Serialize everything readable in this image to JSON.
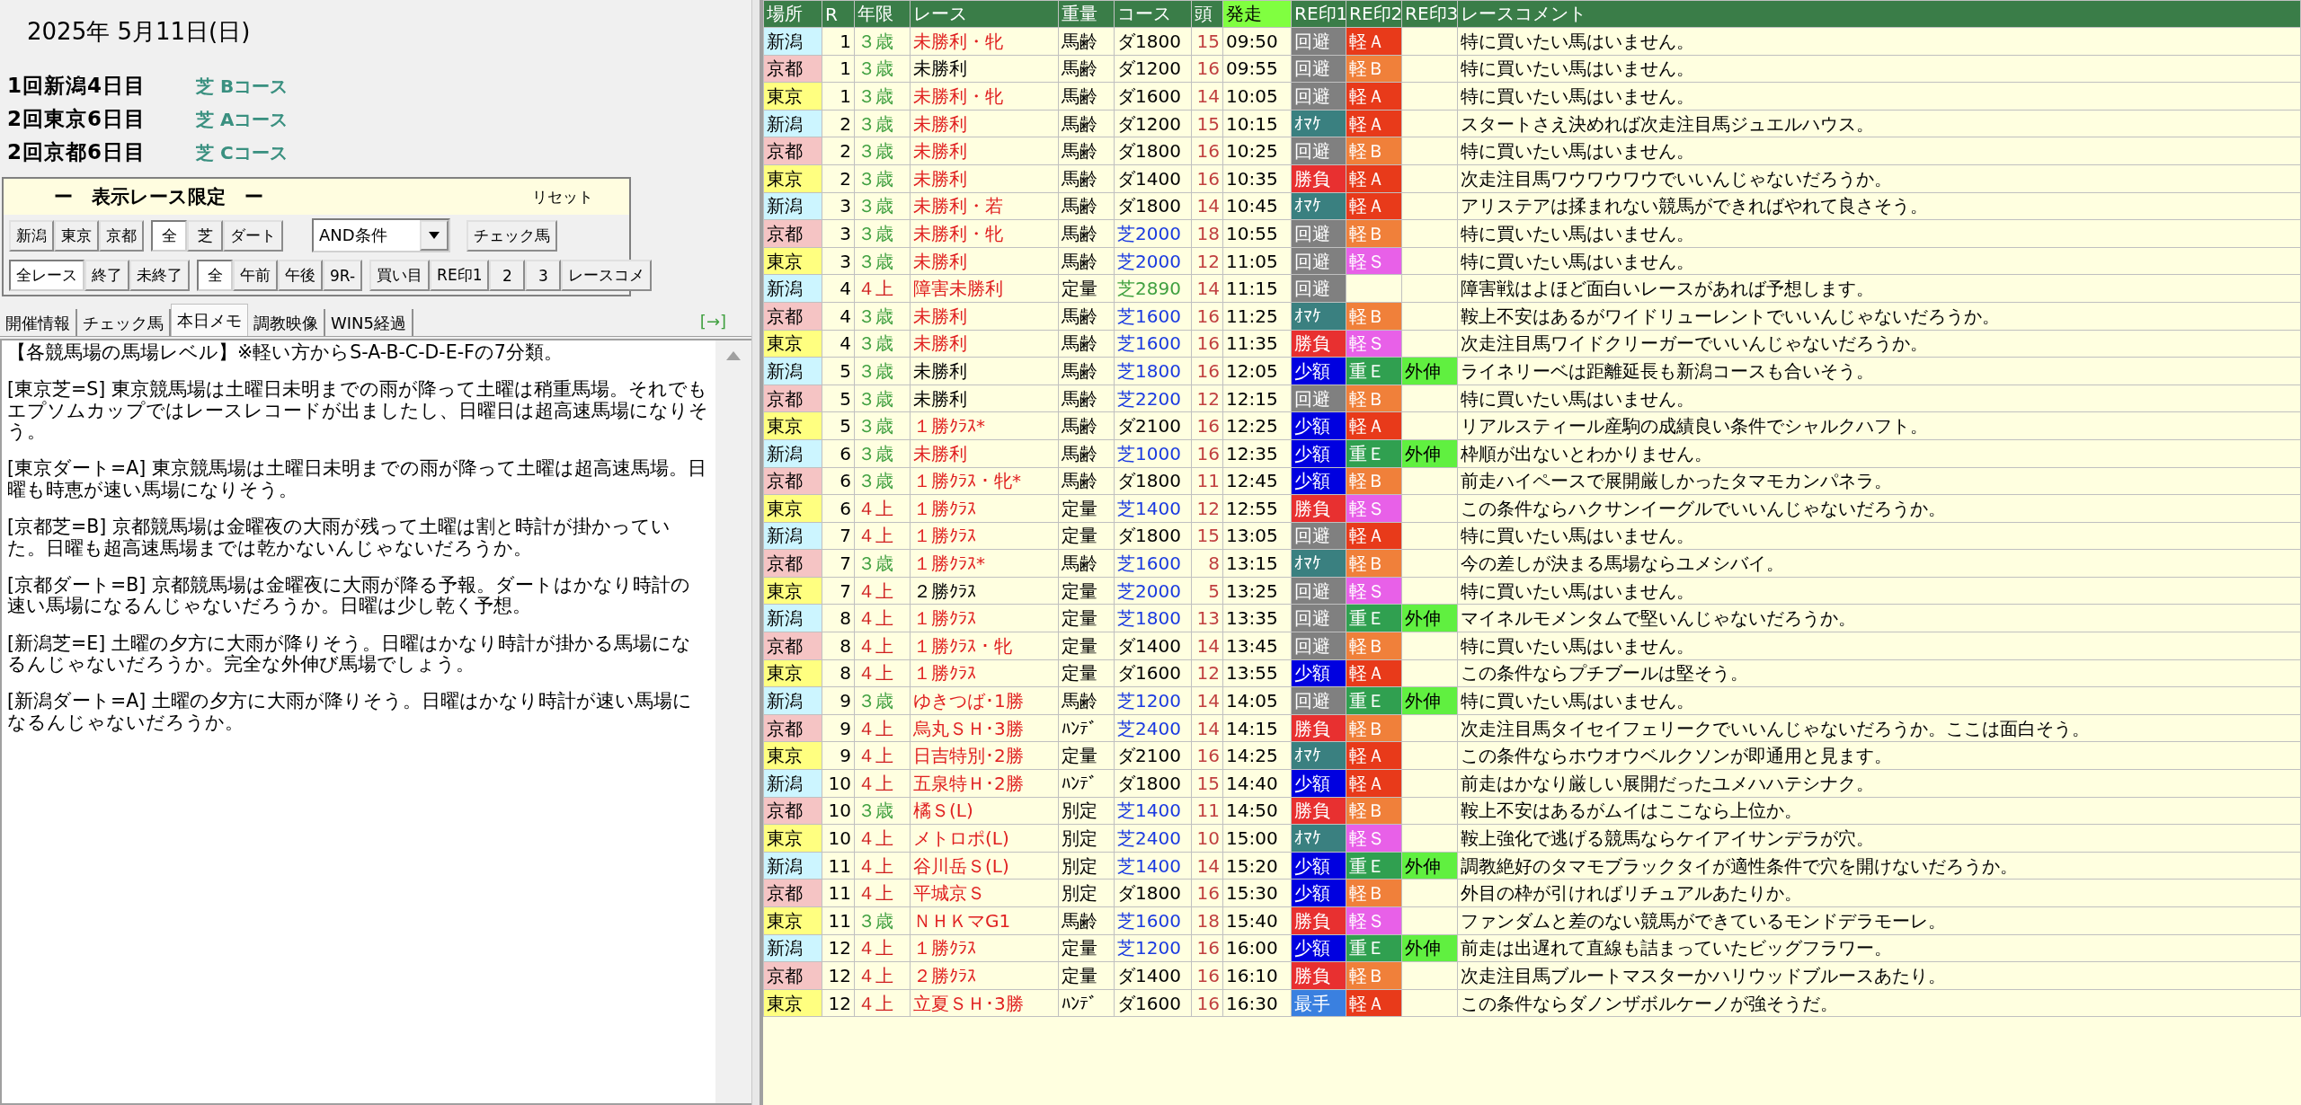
{
  "date": "2025年 5月11日(日)",
  "meetings": [
    {
      "label": "1回新潟4日目",
      "course": "芝 Bコース"
    },
    {
      "label": "2回東京6日目",
      "course": "芝 Aコース"
    },
    {
      "label": "2回京都6日目",
      "course": "芝 Cコース"
    }
  ],
  "filter": {
    "title": "ー　表示レース限定　ー",
    "reset": "リセット",
    "rows": [
      {
        "items": [
          {
            "kind": "group",
            "buttons": [
              {
                "label": "新潟",
                "selected": false
              },
              {
                "label": "東京",
                "selected": false
              },
              {
                "label": "京都",
                "selected": false
              }
            ]
          },
          {
            "kind": "group",
            "buttons": [
              {
                "label": "全",
                "selected": true
              },
              {
                "label": "芝",
                "selected": false
              },
              {
                "label": "ダート",
                "selected": false
              }
            ]
          },
          {
            "kind": "select",
            "value": "AND条件"
          },
          {
            "kind": "group",
            "buttons": [
              {
                "label": "チェック馬",
                "selected": false
              }
            ]
          }
        ]
      },
      {
        "items": [
          {
            "kind": "group",
            "buttons": [
              {
                "label": "全レース",
                "selected": true
              },
              {
                "label": "終了",
                "selected": false
              },
              {
                "label": "未終了",
                "selected": false
              }
            ]
          },
          {
            "kind": "group",
            "buttons": [
              {
                "label": "全",
                "selected": true
              },
              {
                "label": "午前",
                "selected": false
              },
              {
                "label": "午後",
                "selected": false
              },
              {
                "label": "9R-",
                "selected": false
              }
            ]
          },
          {
            "kind": "group",
            "buttons": [
              {
                "label": "買い目",
                "selected": false
              },
              {
                "label": "RE印1",
                "selected": false
              },
              {
                "label": "2",
                "selected": false
              },
              {
                "label": "3",
                "selected": false
              },
              {
                "label": "レースコメ",
                "selected": false
              }
            ]
          }
        ]
      }
    ]
  },
  "tabs": [
    {
      "label": "開催情報",
      "selected": false
    },
    {
      "label": "チェック馬",
      "selected": false
    },
    {
      "label": "本日メモ",
      "selected": true
    },
    {
      "label": "調教映像",
      "selected": false
    },
    {
      "label": "WIN5経過",
      "selected": false
    }
  ],
  "expand_link": "[→]",
  "memo": [
    "【各競馬場の馬場レベル】※軽い方からS-A-B-C-D-E-Fの7分類。",
    "[東京芝=S] 東京競馬場は土曜日未明までの雨が降って土曜は稍重馬場。それでもエプソムカップではレースレコードが出ましたし、日曜日は超高速馬場になりそう。",
    "[東京ダート=A] 東京競馬場は土曜日未明までの雨が降って土曜は超高速馬場。日曜も時恵が速い馬場になりそう。",
    "[京都芝=B] 京都競馬場は金曜夜の大雨が残って土曜は割と時計が掛かっていた。日曜も超高速馬場までは乾かないんじゃないだろうか。",
    "[京都ダート=B] 京都競馬場は金曜夜に大雨が降る予報。ダートはかなり時計の速い馬場になるんじゃないだろうか。日曜は少し乾く予想。",
    "[新潟芝=E] 土曜の夕方に大雨が降りそう。日曜はかなり時計が掛かる馬場になるんじゃないだろうか。完全な外伸び馬場でしょう。",
    "[新潟ダート=A] 土曜の夕方に大雨が降りそう。日曜はかなり時計が速い馬場になるんじゃないだろうか。"
  ],
  "table": {
    "columns": [
      "場所",
      "R",
      "年限",
      "レース",
      "重量",
      "コース",
      "頭",
      "発走",
      "RE印1",
      "RE印2",
      "RE印3",
      "レースコメント"
    ],
    "rows": [
      {
        "venue": {
          "text": "新潟",
          "color": "#ccf5ff"
        },
        "r": "1",
        "age": {
          "text": "３歳",
          "color": "#40a040"
        },
        "race": {
          "text": "未勝利・牝",
          "color": "#e02020"
        },
        "weight": "馬齢",
        "course": {
          "text": "ダ1800",
          "color": "#000000"
        },
        "heads": "15",
        "start": "09:50",
        "r1": {
          "text": "回避",
          "color": "#808080"
        },
        "r2": {
          "text": "軽Ａ",
          "color": "#e83a1a"
        },
        "comment": "特に買いたい馬はいません。"
      },
      {
        "venue": {
          "text": "京都",
          "color": "#f5c4c4"
        },
        "r": "1",
        "age": {
          "text": "３歳",
          "color": "#40a040"
        },
        "race": {
          "text": "未勝利",
          "color": "#000000"
        },
        "weight": "馬齢",
        "course": {
          "text": "ダ1200",
          "color": "#000000"
        },
        "heads": "16",
        "start": "09:55",
        "r1": {
          "text": "回避",
          "color": "#808080"
        },
        "r2": {
          "text": "軽Ｂ",
          "color": "#f0803a"
        },
        "comment": "特に買いたい馬はいません。"
      },
      {
        "venue": {
          "text": "東京",
          "color": "#ffff80"
        },
        "r": "1",
        "age": {
          "text": "３歳",
          "color": "#40a040"
        },
        "race": {
          "text": "未勝利・牝",
          "color": "#e02020"
        },
        "weight": "馬齢",
        "course": {
          "text": "ダ1600",
          "color": "#000000"
        },
        "heads": "14",
        "start": "10:05",
        "r1": {
          "text": "回避",
          "color": "#808080"
        },
        "r2": {
          "text": "軽Ａ",
          "color": "#e83a1a"
        },
        "comment": "特に買いたい馬はいません。"
      },
      {
        "venue": {
          "text": "新潟",
          "color": "#ccf5ff"
        },
        "r": "2",
        "age": {
          "text": "３歳",
          "color": "#40a040"
        },
        "race": {
          "text": "未勝利",
          "color": "#e02020"
        },
        "weight": "馬齢",
        "course": {
          "text": "ダ1200",
          "color": "#000000"
        },
        "heads": "15",
        "start": "10:15",
        "r1": {
          "text": "ｵﾏｹ",
          "color": "#3a8080"
        },
        "r2": {
          "text": "軽Ａ",
          "color": "#e83a1a"
        },
        "comment": "スタートさえ決めれば次走注目馬ジュエルハウス。"
      },
      {
        "venue": {
          "text": "京都",
          "color": "#f5c4c4"
        },
        "r": "2",
        "age": {
          "text": "３歳",
          "color": "#40a040"
        },
        "race": {
          "text": "未勝利",
          "color": "#e02020"
        },
        "weight": "馬齢",
        "course": {
          "text": "ダ1800",
          "color": "#000000"
        },
        "heads": "16",
        "start": "10:25",
        "r1": {
          "text": "回避",
          "color": "#808080"
        },
        "r2": {
          "text": "軽Ｂ",
          "color": "#f0803a"
        },
        "comment": "特に買いたい馬はいません。"
      },
      {
        "venue": {
          "text": "東京",
          "color": "#ffff80"
        },
        "r": "2",
        "age": {
          "text": "３歳",
          "color": "#40a040"
        },
        "race": {
          "text": "未勝利",
          "color": "#e02020"
        },
        "weight": "馬齢",
        "course": {
          "text": "ダ1400",
          "color": "#000000"
        },
        "heads": "16",
        "start": "10:35",
        "r1": {
          "text": "勝負",
          "color": "#e83030"
        },
        "r2": {
          "text": "軽Ａ",
          "color": "#e83a1a"
        },
        "comment": "次走注目馬ワウワウワウでいいんじゃないだろうか。"
      },
      {
        "venue": {
          "text": "新潟",
          "color": "#ccf5ff"
        },
        "r": "3",
        "age": {
          "text": "３歳",
          "color": "#40a040"
        },
        "race": {
          "text": "未勝利・若",
          "color": "#e02020"
        },
        "weight": "馬齢",
        "course": {
          "text": "ダ1800",
          "color": "#000000"
        },
        "heads": "14",
        "start": "10:45",
        "r1": {
          "text": "ｵﾏｹ",
          "color": "#3a8080"
        },
        "r2": {
          "text": "軽Ａ",
          "color": "#e83a1a"
        },
        "comment": "アリステアは揉まれない競馬ができればやれて良さそう。"
      },
      {
        "venue": {
          "text": "京都",
          "color": "#f5c4c4"
        },
        "r": "3",
        "age": {
          "text": "３歳",
          "color": "#40a040"
        },
        "race": {
          "text": "未勝利・牝",
          "color": "#e02020"
        },
        "weight": "馬齢",
        "course": {
          "text": "芝2000",
          "color": "#1a3ae0"
        },
        "heads": "18",
        "start": "10:55",
        "r1": {
          "text": "回避",
          "color": "#808080"
        },
        "r2": {
          "text": "軽Ｂ",
          "color": "#f0803a"
        },
        "comment": "特に買いたい馬はいません。"
      },
      {
        "venue": {
          "text": "東京",
          "color": "#ffff80"
        },
        "r": "3",
        "age": {
          "text": "３歳",
          "color": "#40a040"
        },
        "race": {
          "text": "未勝利",
          "color": "#e02020"
        },
        "weight": "馬齢",
        "course": {
          "text": "芝2000",
          "color": "#1a3ae0"
        },
        "heads": "12",
        "start": "11:05",
        "r1": {
          "text": "回避",
          "color": "#808080"
        },
        "r2": {
          "text": "軽Ｓ",
          "color": "#e860e8"
        },
        "comment": "特に買いたい馬はいません。"
      },
      {
        "venue": {
          "text": "新潟",
          "color": "#ccf5ff"
        },
        "r": "4",
        "age": {
          "text": "４上",
          "color": "#d02020"
        },
        "race": {
          "text": "障害未勝利",
          "color": "#e02020"
        },
        "weight": "定量",
        "course": {
          "text": "芝2890",
          "color": "#40a040"
        },
        "heads": "14",
        "start": "11:15",
        "r1": {
          "text": "回避",
          "color": "#808080"
        },
        "comment": "障害戦はよほど面白いレースがあれば予想します。"
      },
      {
        "venue": {
          "text": "京都",
          "color": "#f5c4c4"
        },
        "r": "4",
        "age": {
          "text": "３歳",
          "color": "#40a040"
        },
        "race": {
          "text": "未勝利",
          "color": "#e02020"
        },
        "weight": "馬齢",
        "course": {
          "text": "芝1600",
          "color": "#1a3ae0"
        },
        "heads": "16",
        "start": "11:25",
        "r1": {
          "text": "ｵﾏｹ",
          "color": "#3a8080"
        },
        "r2": {
          "text": "軽Ｂ",
          "color": "#f0803a"
        },
        "comment": "鞍上不安はあるがワイドリューレントでいいんじゃないだろうか。"
      },
      {
        "venue": {
          "text": "東京",
          "color": "#ffff80"
        },
        "r": "4",
        "age": {
          "text": "３歳",
          "color": "#40a040"
        },
        "race": {
          "text": "未勝利",
          "color": "#e02020"
        },
        "weight": "馬齢",
        "course": {
          "text": "芝1600",
          "color": "#1a3ae0"
        },
        "heads": "16",
        "start": "11:35",
        "r1": {
          "text": "勝負",
          "color": "#e83030"
        },
        "r2": {
          "text": "軽Ｓ",
          "color": "#e860e8"
        },
        "comment": "次走注目馬ワイドクリーガーでいいんじゃないだろうか。"
      },
      {
        "venue": {
          "text": "新潟",
          "color": "#ccf5ff"
        },
        "r": "5",
        "age": {
          "text": "３歳",
          "color": "#40a040"
        },
        "race": {
          "text": "未勝利",
          "color": "#000000"
        },
        "weight": "馬齢",
        "course": {
          "text": "芝1800",
          "color": "#1a3ae0"
        },
        "heads": "16",
        "start": "12:05",
        "r1": {
          "text": "少額",
          "color": "#0000e0"
        },
        "r2": {
          "text": "重Ｅ",
          "color": "#30a050"
        },
        "r3": {
          "text": "外伸",
          "color": "#60f040"
        },
        "comment": "ライネリーベは距離延長も新潟コースも合いそう。"
      },
      {
        "venue": {
          "text": "京都",
          "color": "#f5c4c4"
        },
        "r": "5",
        "age": {
          "text": "３歳",
          "color": "#40a040"
        },
        "race": {
          "text": "未勝利",
          "color": "#000000"
        },
        "weight": "馬齢",
        "course": {
          "text": "芝2200",
          "color": "#1a3ae0"
        },
        "heads": "12",
        "start": "12:15",
        "r1": {
          "text": "回避",
          "color": "#808080"
        },
        "r2": {
          "text": "軽Ｂ",
          "color": "#f0803a"
        },
        "comment": "特に買いたい馬はいません。"
      },
      {
        "venue": {
          "text": "東京",
          "color": "#ffff80"
        },
        "r": "5",
        "age": {
          "text": "３歳",
          "color": "#40a040"
        },
        "race": {
          "text": "１勝ｸﾗｽ*",
          "color": "#e02020"
        },
        "weight": "馬齢",
        "course": {
          "text": "ダ2100",
          "color": "#000000"
        },
        "heads": "16",
        "start": "12:25",
        "r1": {
          "text": "少額",
          "color": "#0000e0"
        },
        "r2": {
          "text": "軽Ａ",
          "color": "#e83a1a"
        },
        "comment": "リアルスティール産駒の成績良い条件でシャルクハフト。"
      },
      {
        "venue": {
          "text": "新潟",
          "color": "#ccf5ff"
        },
        "r": "6",
        "age": {
          "text": "３歳",
          "color": "#40a040"
        },
        "race": {
          "text": "未勝利",
          "color": "#e02020"
        },
        "weight": "馬齢",
        "course": {
          "text": "芝1000",
          "color": "#1a3ae0"
        },
        "heads": "16",
        "start": "12:35",
        "r1": {
          "text": "少額",
          "color": "#0000e0"
        },
        "r2": {
          "text": "重Ｅ",
          "color": "#30a050"
        },
        "r3": {
          "text": "外伸",
          "color": "#60f040"
        },
        "comment": "枠順が出ないとわかりません。"
      },
      {
        "venue": {
          "text": "京都",
          "color": "#f5c4c4"
        },
        "r": "6",
        "age": {
          "text": "３歳",
          "color": "#40a040"
        },
        "race": {
          "text": "１勝ｸﾗｽ・牝*",
          "color": "#e02020"
        },
        "weight": "馬齢",
        "course": {
          "text": "ダ1800",
          "color": "#000000"
        },
        "heads": "11",
        "start": "12:45",
        "r1": {
          "text": "少額",
          "color": "#0000e0"
        },
        "r2": {
          "text": "軽Ｂ",
          "color": "#f0803a"
        },
        "comment": "前走ハイペースで展開厳しかったタマモカンパネラ。"
      },
      {
        "venue": {
          "text": "東京",
          "color": "#ffff80"
        },
        "r": "6",
        "age": {
          "text": "４上",
          "color": "#d02020"
        },
        "race": {
          "text": "１勝ｸﾗｽ",
          "color": "#e02020"
        },
        "weight": "定量",
        "course": {
          "text": "芝1400",
          "color": "#1a3ae0"
        },
        "heads": "12",
        "start": "12:55",
        "r1": {
          "text": "勝負",
          "color": "#e83030"
        },
        "r2": {
          "text": "軽Ｓ",
          "color": "#e860e8"
        },
        "comment": "この条件ならハクサンイーグルでいいんじゃないだろうか。"
      },
      {
        "venue": {
          "text": "新潟",
          "color": "#ccf5ff"
        },
        "r": "7",
        "age": {
          "text": "４上",
          "color": "#d02020"
        },
        "race": {
          "text": "１勝ｸﾗｽ",
          "color": "#e02020"
        },
        "weight": "定量",
        "course": {
          "text": "ダ1800",
          "color": "#000000"
        },
        "heads": "15",
        "start": "13:05",
        "r1": {
          "text": "回避",
          "color": "#808080"
        },
        "r2": {
          "text": "軽Ａ",
          "color": "#e83a1a"
        },
        "comment": "特に買いたい馬はいません。"
      },
      {
        "venue": {
          "text": "京都",
          "color": "#f5c4c4"
        },
        "r": "7",
        "age": {
          "text": "３歳",
          "color": "#40a040"
        },
        "race": {
          "text": "１勝ｸﾗｽ*",
          "color": "#e02020"
        },
        "weight": "馬齢",
        "course": {
          "text": "芝1600",
          "color": "#1a3ae0"
        },
        "heads": "8",
        "start": "13:15",
        "r1": {
          "text": "ｵﾏｹ",
          "color": "#3a8080"
        },
        "r2": {
          "text": "軽Ｂ",
          "color": "#f0803a"
        },
        "comment": "今の差しが決まる馬場ならユメシバイ。"
      },
      {
        "venue": {
          "text": "東京",
          "color": "#ffff80"
        },
        "r": "7",
        "age": {
          "text": "４上",
          "color": "#d02020"
        },
        "race": {
          "text": "２勝ｸﾗｽ",
          "color": "#000000"
        },
        "weight": "定量",
        "course": {
          "text": "芝2000",
          "color": "#1a3ae0"
        },
        "heads": "5",
        "start": "13:25",
        "r1": {
          "text": "回避",
          "color": "#808080"
        },
        "r2": {
          "text": "軽Ｓ",
          "color": "#e860e8"
        },
        "comment": "特に買いたい馬はいません。"
      },
      {
        "venue": {
          "text": "新潟",
          "color": "#ccf5ff"
        },
        "r": "8",
        "age": {
          "text": "４上",
          "color": "#d02020"
        },
        "race": {
          "text": "１勝ｸﾗｽ",
          "color": "#e02020"
        },
        "weight": "定量",
        "course": {
          "text": "芝1800",
          "color": "#1a3ae0"
        },
        "heads": "13",
        "start": "13:35",
        "r1": {
          "text": "回避",
          "color": "#808080"
        },
        "r2": {
          "text": "重Ｅ",
          "color": "#30a050"
        },
        "r3": {
          "text": "外伸",
          "color": "#60f040"
        },
        "comment": "マイネルモメンタムで堅いんじゃないだろうか。"
      },
      {
        "venue": {
          "text": "京都",
          "color": "#f5c4c4"
        },
        "r": "8",
        "age": {
          "text": "４上",
          "color": "#d02020"
        },
        "race": {
          "text": "１勝ｸﾗｽ・牝",
          "color": "#e02020"
        },
        "weight": "定量",
        "course": {
          "text": "ダ1400",
          "color": "#000000"
        },
        "heads": "14",
        "start": "13:45",
        "r1": {
          "text": "回避",
          "color": "#808080"
        },
        "r2": {
          "text": "軽Ｂ",
          "color": "#f0803a"
        },
        "comment": "特に買いたい馬はいません。"
      },
      {
        "venue": {
          "text": "東京",
          "color": "#ffff80"
        },
        "r": "8",
        "age": {
          "text": "４上",
          "color": "#d02020"
        },
        "race": {
          "text": "１勝ｸﾗｽ",
          "color": "#e02020"
        },
        "weight": "定量",
        "course": {
          "text": "ダ1600",
          "color": "#000000"
        },
        "heads": "12",
        "start": "13:55",
        "r1": {
          "text": "少額",
          "color": "#0000e0"
        },
        "r2": {
          "text": "軽Ａ",
          "color": "#e83a1a"
        },
        "comment": "この条件ならプチブールは堅そう。"
      },
      {
        "venue": {
          "text": "新潟",
          "color": "#ccf5ff"
        },
        "r": "9",
        "age": {
          "text": "３歳",
          "color": "#40a040"
        },
        "race": {
          "text": "ゆきつば･1勝",
          "color": "#e02020"
        },
        "weight": "馬齢",
        "course": {
          "text": "芝1200",
          "color": "#1a3ae0"
        },
        "heads": "14",
        "start": "14:05",
        "r1": {
          "text": "回避",
          "color": "#808080"
        },
        "r2": {
          "text": "重Ｅ",
          "color": "#30a050"
        },
        "r3": {
          "text": "外伸",
          "color": "#60f040"
        },
        "comment": "特に買いたい馬はいません。"
      },
      {
        "venue": {
          "text": "京都",
          "color": "#f5c4c4"
        },
        "r": "9",
        "age": {
          "text": "４上",
          "color": "#d02020"
        },
        "race": {
          "text": "烏丸ＳＨ･3勝",
          "color": "#e02020"
        },
        "weight": "ﾊﾝﾃﾞ",
        "course": {
          "text": "芝2400",
          "color": "#1a3ae0"
        },
        "heads": "14",
        "start": "14:15",
        "r1": {
          "text": "勝負",
          "color": "#e83030"
        },
        "r2": {
          "text": "軽Ｂ",
          "color": "#f0803a"
        },
        "comment": "次走注目馬タイセイフェリークでいいんじゃないだろうか。ここは面白そう。"
      },
      {
        "venue": {
          "text": "東京",
          "color": "#ffff80"
        },
        "r": "9",
        "age": {
          "text": "４上",
          "color": "#d02020"
        },
        "race": {
          "text": "日吉特別･2勝",
          "color": "#e02020"
        },
        "weight": "定量",
        "course": {
          "text": "ダ2100",
          "color": "#000000"
        },
        "heads": "16",
        "start": "14:25",
        "r1": {
          "text": "ｵﾏｹ",
          "color": "#3a8080"
        },
        "r2": {
          "text": "軽Ａ",
          "color": "#e83a1a"
        },
        "comment": "この条件ならホウオウベルクソンが即通用と見ます。"
      },
      {
        "venue": {
          "text": "新潟",
          "color": "#ccf5ff"
        },
        "r": "10",
        "age": {
          "text": "４上",
          "color": "#d02020"
        },
        "race": {
          "text": "五泉特Ｈ･2勝",
          "color": "#e02020"
        },
        "weight": "ﾊﾝﾃﾞ",
        "course": {
          "text": "ダ1800",
          "color": "#000000"
        },
        "heads": "15",
        "start": "14:40",
        "r1": {
          "text": "少額",
          "color": "#0000e0"
        },
        "r2": {
          "text": "軽Ａ",
          "color": "#e83a1a"
        },
        "comment": "前走はかなり厳しい展開だったユメハハテシナク。"
      },
      {
        "venue": {
          "text": "京都",
          "color": "#f5c4c4"
        },
        "r": "10",
        "age": {
          "text": "３歳",
          "color": "#40a040"
        },
        "race": {
          "text": "橘Ｓ(L)",
          "color": "#e02020"
        },
        "weight": "別定",
        "course": {
          "text": "芝1400",
          "color": "#1a3ae0"
        },
        "heads": "11",
        "start": "14:50",
        "r1": {
          "text": "勝負",
          "color": "#e83030"
        },
        "r2": {
          "text": "軽Ｂ",
          "color": "#f0803a"
        },
        "comment": "鞍上不安はあるがムイはここなら上位か。"
      },
      {
        "venue": {
          "text": "東京",
          "color": "#ffff80"
        },
        "r": "10",
        "age": {
          "text": "４上",
          "color": "#d02020"
        },
        "race": {
          "text": "メトロポ(L)",
          "color": "#e02020"
        },
        "weight": "別定",
        "course": {
          "text": "芝2400",
          "color": "#1a3ae0"
        },
        "heads": "10",
        "start": "15:00",
        "r1": {
          "text": "ｵﾏｹ",
          "color": "#3a8080"
        },
        "r2": {
          "text": "軽Ｓ",
          "color": "#e860e8"
        },
        "comment": "鞍上強化で逃げる競馬ならケイアイサンデラが穴。"
      },
      {
        "venue": {
          "text": "新潟",
          "color": "#ccf5ff"
        },
        "r": "11",
        "age": {
          "text": "４上",
          "color": "#d02020"
        },
        "race": {
          "text": "谷川岳Ｓ(L)",
          "color": "#e02020"
        },
        "weight": "別定",
        "course": {
          "text": "芝1400",
          "color": "#1a3ae0"
        },
        "heads": "14",
        "start": "15:20",
        "r1": {
          "text": "少額",
          "color": "#0000e0"
        },
        "r2": {
          "text": "重Ｅ",
          "color": "#30a050"
        },
        "r3": {
          "text": "外伸",
          "color": "#60f040"
        },
        "comment": "調教絶好のタマモブラックタイが適性条件で穴を開けないだろうか。"
      },
      {
        "venue": {
          "text": "京都",
          "color": "#f5c4c4"
        },
        "r": "11",
        "age": {
          "text": "４上",
          "color": "#d02020"
        },
        "race": {
          "text": "平城京Ｓ",
          "color": "#e02020"
        },
        "weight": "別定",
        "course": {
          "text": "ダ1800",
          "color": "#000000"
        },
        "heads": "16",
        "start": "15:30",
        "r1": {
          "text": "少額",
          "color": "#0000e0"
        },
        "r2": {
          "text": "軽Ｂ",
          "color": "#f0803a"
        },
        "comment": "外目の枠が引ければリチュアルあたりか。"
      },
      {
        "venue": {
          "text": "東京",
          "color": "#ffff80"
        },
        "r": "11",
        "age": {
          "text": "３歳",
          "color": "#40a040"
        },
        "race": {
          "text": "ＮＨＫマG1",
          "color": "#e02020"
        },
        "weight": "馬齢",
        "course": {
          "text": "芝1600",
          "color": "#1a3ae0"
        },
        "heads": "18",
        "start": "15:40",
        "r1": {
          "text": "勝負",
          "color": "#e83030"
        },
        "r2": {
          "text": "軽Ｓ",
          "color": "#e860e8"
        },
        "comment": "ファンダムと差のない競馬ができているモンドデラモーレ。"
      },
      {
        "venue": {
          "text": "新潟",
          "color": "#ccf5ff"
        },
        "r": "12",
        "age": {
          "text": "４上",
          "color": "#d02020"
        },
        "race": {
          "text": "１勝ｸﾗｽ",
          "color": "#e02020"
        },
        "weight": "定量",
        "course": {
          "text": "芝1200",
          "color": "#1a3ae0"
        },
        "heads": "16",
        "start": "16:00",
        "r1": {
          "text": "少額",
          "color": "#0000e0"
        },
        "r2": {
          "text": "重Ｅ",
          "color": "#30a050"
        },
        "r3": {
          "text": "外伸",
          "color": "#60f040"
        },
        "comment": "前走は出遅れて直線も詰まっていたビッグフラワー。"
      },
      {
        "venue": {
          "text": "京都",
          "color": "#f5c4c4"
        },
        "r": "12",
        "age": {
          "text": "４上",
          "color": "#d02020"
        },
        "race": {
          "text": "２勝ｸﾗｽ",
          "color": "#e02020"
        },
        "weight": "定量",
        "course": {
          "text": "ダ1400",
          "color": "#000000"
        },
        "heads": "16",
        "start": "16:10",
        "r1": {
          "text": "勝負",
          "color": "#e83030"
        },
        "r2": {
          "text": "軽Ｂ",
          "color": "#f0803a"
        },
        "comment": "次走注目馬ブルートマスターかハリウッドブルースあたり。"
      },
      {
        "venue": {
          "text": "東京",
          "color": "#ffff80"
        },
        "r": "12",
        "age": {
          "text": "４上",
          "color": "#d02020"
        },
        "race": {
          "text": "立夏ＳＨ･3勝",
          "color": "#e02020"
        },
        "weight": "ﾊﾝﾃﾞ",
        "course": {
          "text": "ダ1600",
          "color": "#000000"
        },
        "heads": "16",
        "start": "16:30",
        "r1": {
          "text": "最手",
          "color": "#3a80e0"
        },
        "r2": {
          "text": "軽Ａ",
          "color": "#e83a1a"
        },
        "comment": "この条件ならダノンザボルケーノが強そうだ。"
      }
    ]
  }
}
